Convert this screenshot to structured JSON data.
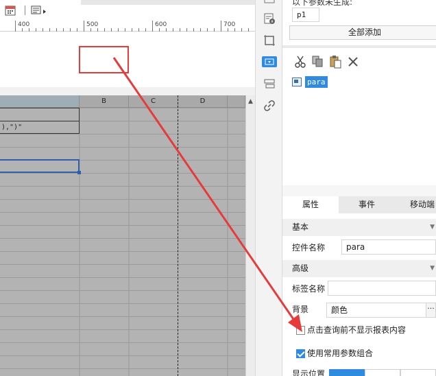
{
  "ruler": {
    "ticks": [
      "400",
      "500",
      "600",
      "700"
    ]
  },
  "sheet": {
    "columns": [
      "B",
      "C",
      "D"
    ],
    "formula_cell": "),\")\""
  },
  "params_panel": {
    "header_partial": "以下参数未生成:",
    "param_name": "p1",
    "add_all_button": "全部添加"
  },
  "widget_tree": {
    "item_label": "para"
  },
  "tabs": [
    "属性",
    "事件",
    "移动端"
  ],
  "properties": {
    "basic_section": "基本",
    "control_name_label": "控件名称",
    "control_name_value": "para",
    "advanced_section": "高级",
    "tag_name_label": "标签名称",
    "tag_name_value": "",
    "background_label": "背景",
    "background_value": "颜色",
    "ellipsis": "···",
    "hide_before_query": {
      "label": "点击查询前不显示报表内容",
      "checked": false
    },
    "use_common_params": {
      "label": "使用常用参数组合",
      "checked": true
    },
    "display_position_label": "显示位置"
  },
  "colors": {
    "accent": "#2f8be0",
    "annotation_red": "#e53b3b",
    "selection_blue": "#2f5fa8"
  }
}
